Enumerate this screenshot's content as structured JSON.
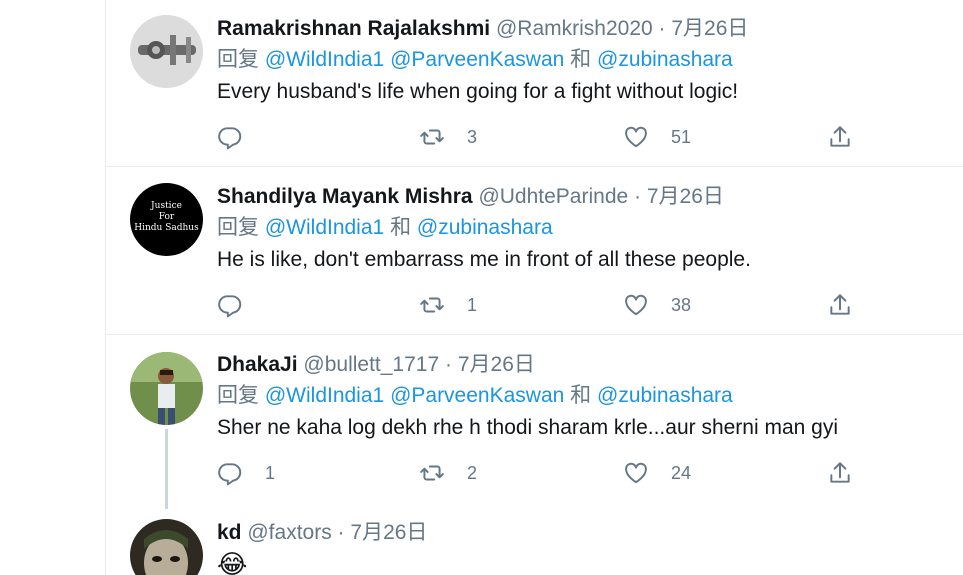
{
  "reply_prefix": "回复",
  "and_word": "和",
  "tweets": [
    {
      "name": "Ramakrishnan Rajalakshmi",
      "handle": "@Ramkrish2020",
      "date": "7月26日",
      "mentions": [
        "@WildIndia1",
        "@ParveenKaswan",
        "@zubinashara"
      ],
      "text": "Every husband's life when going for a fight without logic!",
      "replies": "",
      "retweets": "3",
      "likes": "51"
    },
    {
      "name": "Shandilya Mayank Mishra",
      "handle": "@UdhteParinde",
      "date": "7月26日",
      "mentions": [
        "@WildIndia1",
        "@zubinashara"
      ],
      "text": "He is like, don't embarrass me in front of all these people.",
      "replies": "",
      "retweets": "1",
      "likes": "38",
      "avatar_text": [
        "Justice",
        "For",
        "Hindu Sadhus"
      ]
    },
    {
      "name": "DhakaJi",
      "handle": "@bullett_1717",
      "date": "7月26日",
      "mentions": [
        "@WildIndia1",
        "@ParveenKaswan",
        "@zubinashara"
      ],
      "text": "Sher ne kaha log dekh rhe h thodi sharam krle...aur sherni man gyi",
      "replies": "1",
      "retweets": "2",
      "likes": "24"
    },
    {
      "name": "kd",
      "handle": "@faxtors",
      "date": "7月26日",
      "text": "😂"
    }
  ],
  "colors": {
    "text": "#14171a",
    "secondary": "#657786",
    "link": "#1b95e0",
    "divider": "#e6ecf0",
    "thread": "#ccd6dd"
  },
  "icons": [
    "reply-icon",
    "retweet-icon",
    "like-icon",
    "share-icon"
  ]
}
